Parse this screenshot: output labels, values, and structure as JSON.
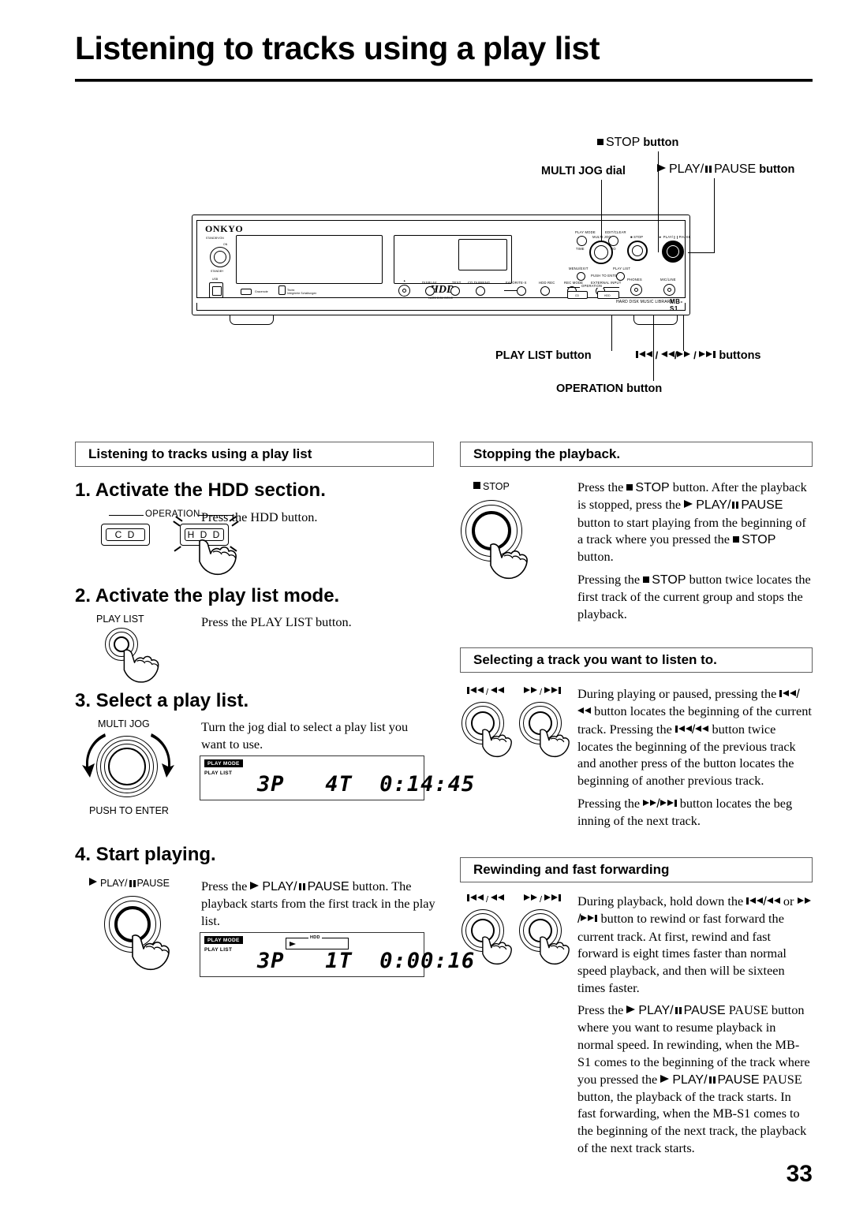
{
  "page": {
    "title": "Listening to tracks using a play list",
    "number": "33"
  },
  "diagram": {
    "device_model": "MB-S1",
    "device_subtitle": "HARD DISK MUSIC LIBRARY",
    "brand": "ONKYO",
    "standby_label": "STANDBY/ON",
    "standby_on": "ON",
    "standby_off": "STANDBY",
    "usb_label": "USB",
    "hdd_logo": "HDD",
    "hdd_logo_sub": "HARD DISK DRIVE",
    "front_buttons": [
      "DISPLAY",
      "TEXT",
      "CD DUBBING",
      "FAVORITE-X",
      "HDD REC",
      "REC MODE",
      "EXTERNAL INPUT"
    ],
    "panel_labels": {
      "play_mode": "PLAY MODE",
      "edit_clear": "EDIT/CLEAR",
      "multi_jog": "MULTI JOG",
      "menu_exit": "MENU/EXIT",
      "play_list": "PLAY LIST",
      "push_to_enter": "PUSH TO ENTER",
      "time": "TIME",
      "no": "NO",
      "operation": "OPERATION",
      "operation_cd": "CD",
      "operation_hdd": "HDD",
      "stop": "STOP",
      "play_pause": "PLAY/  PAUSE",
      "phones": "PHONES",
      "mic": "MIC/LINE"
    },
    "callouts": {
      "stop_button": "STOP",
      "stop_button_suffix": "button",
      "multi_jog_dial": "MULTI JOG dial",
      "play_pause_prefix": "PLAY/",
      "play_pause_suffix": "PAUSE",
      "play_pause_word": "button",
      "play_list_button": "PLAY LIST button",
      "skip_buttons_suffix": "buttons",
      "operation_button": "OPERATION button"
    }
  },
  "left_column": {
    "section_header": "Listening to tracks using a play list",
    "steps": [
      {
        "heading": "1. Activate the HDD section.",
        "text": "Press the HDD button.",
        "illustration_labels": {
          "operation": "OPERATION",
          "cd": "C D",
          "hdd": "H D D"
        }
      },
      {
        "heading": "2. Activate the play list mode.",
        "text": "Press the PLAY LIST button.",
        "illustration_labels": {
          "button": "PLAY LIST"
        }
      },
      {
        "heading": "3. Select a play list.",
        "text": "Turn the jog dial to select a play list you want to use.",
        "illustration_labels": {
          "dial": "MULTI JOG",
          "push": "PUSH TO ENTER"
        },
        "display": {
          "play_mode_badge": "PLAY MODE",
          "play_list_label": "PLAY LIST",
          "readout": "3P   4T  0:14:45",
          "playlist_number": "3P",
          "track_number": "4T",
          "time": "0:14:45",
          "hdd_indicator": false
        }
      },
      {
        "heading": "4. Start playing.",
        "heading_suffix": ".",
        "text_before": "Press the",
        "text_after": "button. The playback starts from the first track in the play list.",
        "illustration_labels": {
          "button_prefix": "PLAY/",
          "button_suffix": "PAUSE"
        },
        "display": {
          "play_mode_badge": "PLAY MODE",
          "play_list_label": "PLAY LIST",
          "readout": "3P   1T  0:00:16",
          "playlist_number": "3P",
          "track_number": "1T",
          "time": "0:00:16",
          "hdd_indicator": true,
          "hdd_indicator_label": "HDD"
        }
      }
    ]
  },
  "right_column": {
    "sections": [
      {
        "header": "Stopping the playback.",
        "illustration_label": "STOP",
        "paragraph1_a": "Press the",
        "paragraph1_b": "STOP button. After the playback is stopped, press the",
        "paragraph1_c": "PLAY/",
        "paragraph1_d": "PAUSE button to start playing from the beginning of a track where you pressed the",
        "paragraph1_e": "STOP button.",
        "paragraph2_a": "Pressing the",
        "paragraph2_b": "STOP button twice locates the first track of the current group and stops the playback."
      },
      {
        "header": "Selecting a track you want to listen to.",
        "illustration_label_left": "prev/rew",
        "illustration_label_right": "ff/next",
        "paragraph1_a": "During playing or paused, pressing the",
        "paragraph1_b": "button locates the beginning of the current track. Pressing the",
        "paragraph1_c": "button twice locates the beginning of the previous track and another press of the button locates the beginning of another previous track.",
        "paragraph2_a": "Pressing the",
        "paragraph2_b": "button locates the beg inning of the next track."
      },
      {
        "header": "Rewinding and fast forwarding",
        "illustration_label_left": "prev/rew",
        "illustration_label_right": "ff/next",
        "paragraph1_a": "During playback, hold down the",
        "paragraph1_b": "or",
        "paragraph1_c": "button to rewind or fast forward the current track. At first, rewind and fast forward is eight times faster than normal speed playback, and then will be sixteen times faster.",
        "paragraph2_a": "Press the",
        "paragraph2_b": "PLAY/",
        "paragraph2_c": "PAUSE button where you want to resume playback in normal speed. In rewinding, when the MB-S1 comes to the beginning of the track where you pressed the",
        "paragraph2_d": "PLAY/",
        "paragraph2_e": "PAUSE button, the playback of the track starts. In fast forwarding, when the MB-S1 comes to the beginning of the next track, the playback of the next track starts."
      }
    ]
  }
}
